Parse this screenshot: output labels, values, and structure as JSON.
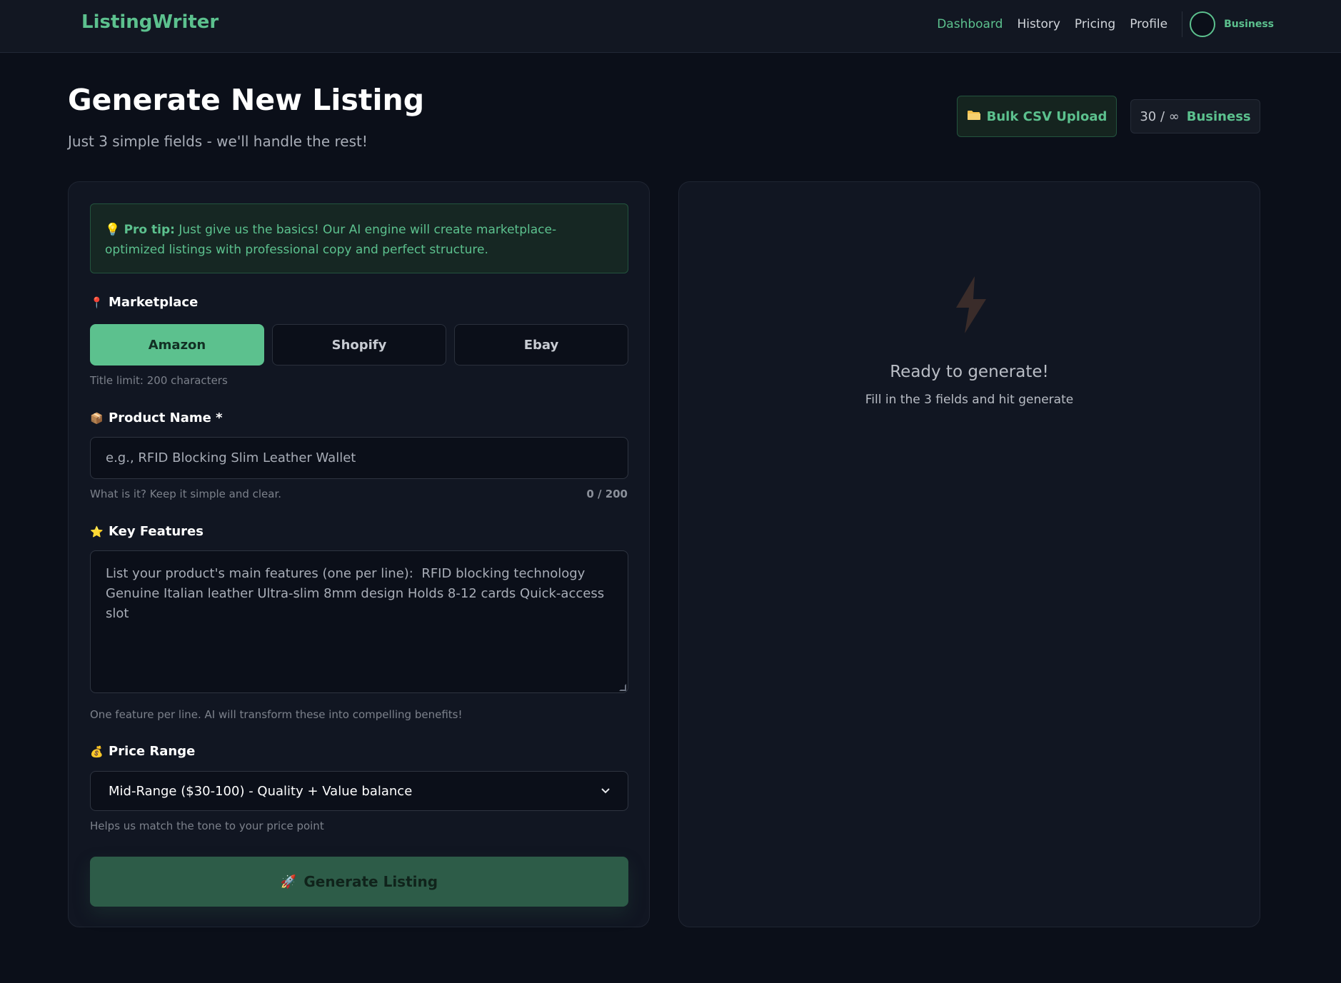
{
  "nav": {
    "brand": "ListingWriter",
    "links": [
      "Dashboard",
      "History",
      "Pricing",
      "Profile"
    ],
    "plan_label": "Business"
  },
  "header": {
    "title": "Generate New Listing",
    "subtitle": "Just 3 simple fields - we'll handle the rest!",
    "bulk_upload_label": "Bulk CSV Upload",
    "usage": "30 / ∞",
    "plan": "Business"
  },
  "form": {
    "protip_label": "Pro tip:",
    "protip_text": "Just give us the basics! Our AI engine will create marketplace-optimized listings with professional copy and perfect structure.",
    "marketplace": {
      "label": "Marketplace",
      "options": [
        "Amazon",
        "Shopify",
        "Ebay"
      ],
      "selected": "Amazon",
      "hint": "Title limit: 200 characters"
    },
    "product_name": {
      "label": "Product Name *",
      "placeholder": "e.g., RFID Blocking Slim Leather Wallet",
      "value": "",
      "hint": "What is it? Keep it simple and clear.",
      "counter": "0 / 200"
    },
    "key_features": {
      "label": "Key Features",
      "placeholder": "List your product's main features (one per line):  RFID blocking technology Genuine Italian leather Ultra-slim 8mm design Holds 8-12 cards Quick-access slot",
      "hint": "One feature per line. AI will transform these into compelling benefits!"
    },
    "price_range": {
      "label": "Price Range",
      "selected": "Mid-Range ($30-100) - Quality + Value balance",
      "hint": "Helps us match the tone to your price point"
    },
    "generate_label": "Generate Listing"
  },
  "result": {
    "title": "Ready to generate!",
    "subtitle": "Fill in the 3 fields and hit generate"
  },
  "colors": {
    "accent": "#5cc18e",
    "background": "#0b0f19",
    "card": "#111622"
  },
  "icons": {
    "protip": "lightbulb-icon",
    "marketplace": "pin-icon",
    "product_name": "package-icon",
    "key_features": "star-icon",
    "price_range": "money-bag-icon",
    "generate": "rocket-icon",
    "bulk_upload": "folder-icon",
    "placeholder": "lightning-bolt-icon"
  }
}
